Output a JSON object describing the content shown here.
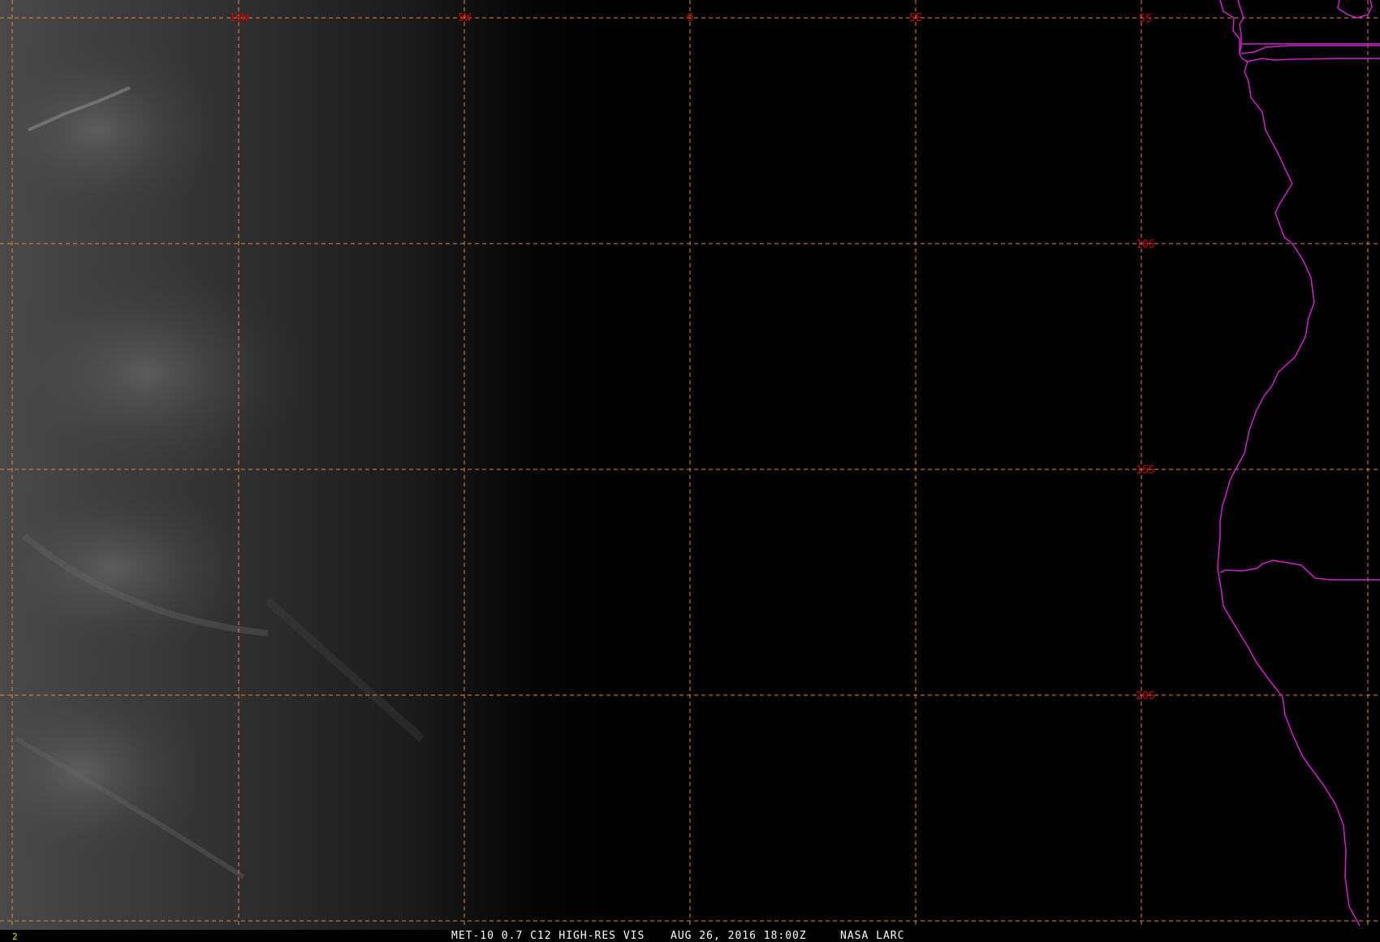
{
  "map": {
    "lon_labels": [
      "10W",
      "5W",
      "0",
      "5E"
    ],
    "lat_labels": [
      "5S",
      "10S",
      "15S",
      "20S"
    ],
    "grid_color": "#e08a3c",
    "label_color": "#d00000",
    "coast_color": "#d020d0"
  },
  "footer": {
    "frame_number": "2",
    "product": "MET-10 0.7 C12 HIGH-RES VIS",
    "datetime": "AUG 26, 2016 18:00Z",
    "source": "NASA LARC"
  }
}
